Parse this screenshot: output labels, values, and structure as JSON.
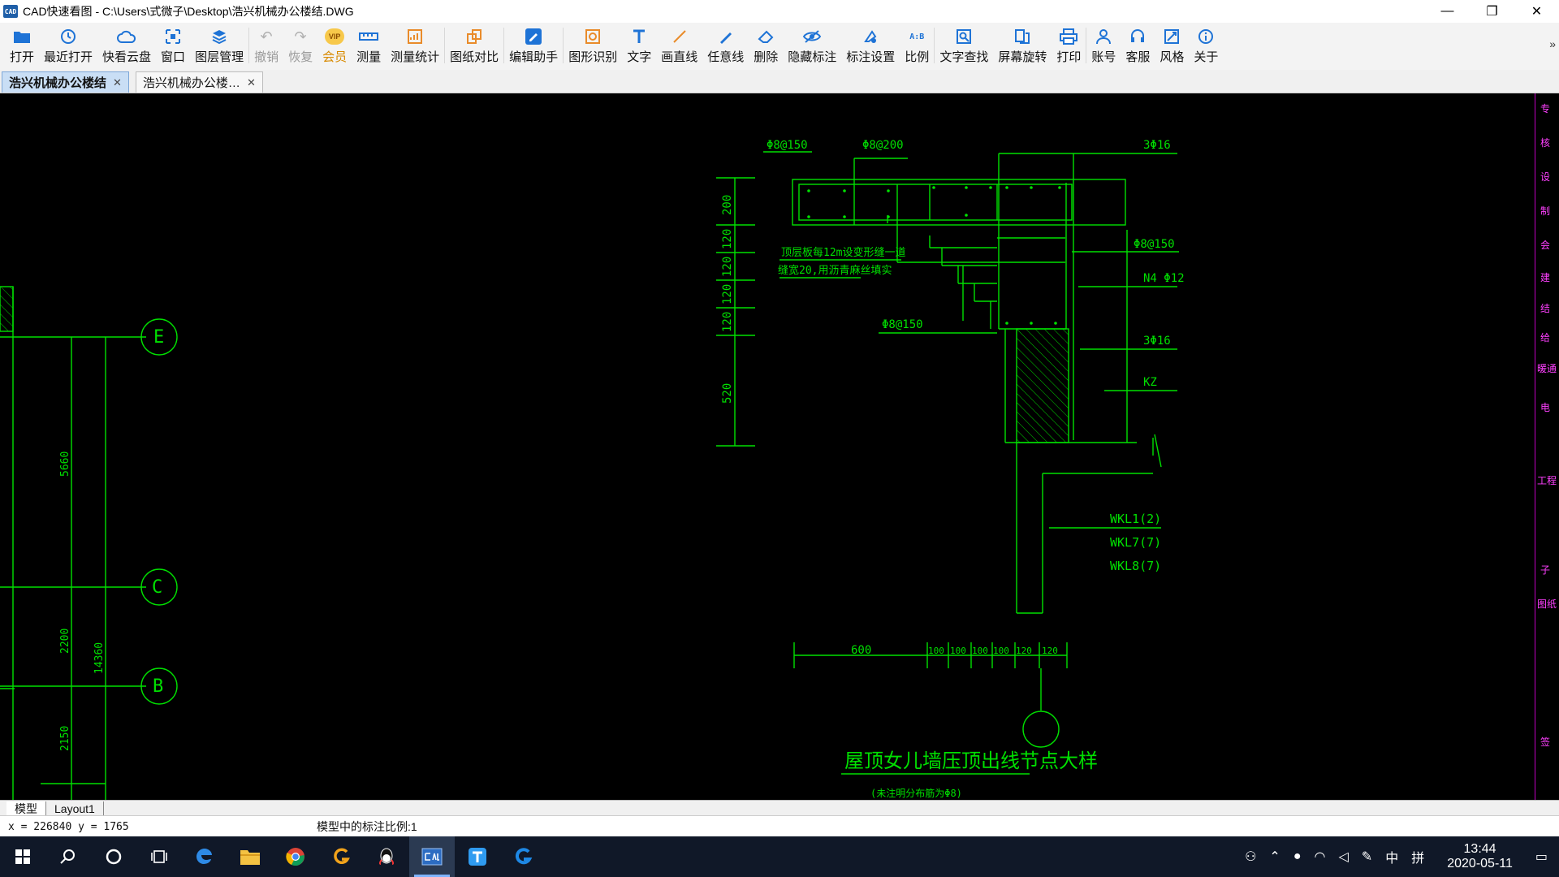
{
  "window": {
    "app_icon_text": "CAD",
    "title": "CAD快速看图 - C:\\Users\\式微子\\Desktop\\浩兴机械办公楼结.DWG",
    "minimize": "—",
    "restore": "❐",
    "close": "✕"
  },
  "toolbar": {
    "items": [
      {
        "label": "打开",
        "icon": "folder-icon"
      },
      {
        "label": "最近打开",
        "icon": "clock-icon"
      },
      {
        "label": "快看云盘",
        "icon": "cloud-icon"
      },
      {
        "label": "窗口",
        "icon": "window-icon"
      },
      {
        "label": "图层管理",
        "icon": "layers-icon"
      },
      {
        "label": "撤销",
        "icon": "undo-icon"
      },
      {
        "label": "恢复",
        "icon": "redo-icon"
      },
      {
        "label": "会员",
        "icon": "vip-icon"
      },
      {
        "label": "测量",
        "icon": "ruler-icon"
      },
      {
        "label": "测量统计",
        "icon": "measure-stats-icon"
      },
      {
        "label": "图纸对比",
        "icon": "compare-icon"
      },
      {
        "label": "编辑助手",
        "icon": "edit-assistant-icon"
      },
      {
        "label": "图形识别",
        "icon": "shape-recognition-icon"
      },
      {
        "label": "文字",
        "icon": "text-icon"
      },
      {
        "label": "画直线",
        "icon": "line-icon"
      },
      {
        "label": "任意线",
        "icon": "freehand-icon"
      },
      {
        "label": "删除",
        "icon": "eraser-icon"
      },
      {
        "label": "隐藏标注",
        "icon": "eye-hide-icon"
      },
      {
        "label": "标注设置",
        "icon": "annotation-settings-icon"
      },
      {
        "label": "比例",
        "icon": "scale-icon"
      },
      {
        "label": "文字查找",
        "icon": "text-search-icon"
      },
      {
        "label": "屏幕旋转",
        "icon": "rotate-screen-icon"
      },
      {
        "label": "打印",
        "icon": "printer-icon"
      },
      {
        "label": "账号",
        "icon": "user-icon"
      },
      {
        "label": "客服",
        "icon": "headset-icon"
      },
      {
        "label": "风格",
        "icon": "style-icon"
      },
      {
        "label": "关于",
        "icon": "info-icon"
      }
    ],
    "more": "»",
    "vip_glyph": "VIP",
    "ab_glyph": "A:B"
  },
  "tabs": [
    {
      "label": "浩兴机械办公楼结",
      "close": "✕"
    },
    {
      "label": "浩兴机械办公楼…",
      "close": "✕"
    }
  ],
  "drawing": {
    "grid_labels": [
      "E",
      "C",
      "B"
    ],
    "dims_left": [
      "5660",
      "2200",
      "14360",
      "2150"
    ],
    "dims_vertical": [
      "200",
      "120",
      "120",
      "120",
      "120",
      "520"
    ],
    "dims_bottom": [
      "600",
      "100",
      "100",
      "100",
      "100",
      "120",
      "120"
    ],
    "rebar_top": [
      "Φ8@150",
      "Φ8@200",
      "3Φ16"
    ],
    "rebar_right": [
      "Φ8@150",
      "N4 Φ12",
      "3Φ16",
      "KZ"
    ],
    "rebar_inner": "Φ8@150",
    "note_line1": "顶层板每12m设变形缝一道",
    "note_line2": "缝宽20,用沥青麻丝填实",
    "beam_labels": [
      "WKL1(2)",
      "WKL7(7)",
      "WKL8(7)"
    ],
    "detail_title": "屋顶女儿墙压顶出线节点大样",
    "detail_subtitle": "(未注明分布筋为Φ8)"
  },
  "right_strip": [
    "专",
    "核",
    "设",
    "制",
    "会",
    "建",
    "结",
    "给",
    "暖通",
    "电",
    "工程",
    "子",
    "图纸",
    "签"
  ],
  "layout_tabs": [
    "模型",
    "Layout1"
  ],
  "status": {
    "coords": "x = 226840  y = 1765",
    "scale": "模型中的标注比例:1"
  },
  "taskbar": {
    "icons": [
      "windows-start-icon",
      "search-icon",
      "cortana-icon",
      "task-view-icon",
      "edge-icon",
      "file-explorer-icon",
      "chrome-icon",
      "g-app-icon",
      "qq-icon",
      "cad-app-icon",
      "t-app-icon",
      "g-blue-app-icon"
    ],
    "tray_ime": "中",
    "tray_ime2": "拼",
    "time": "13:44",
    "date": "2020-05-11"
  }
}
